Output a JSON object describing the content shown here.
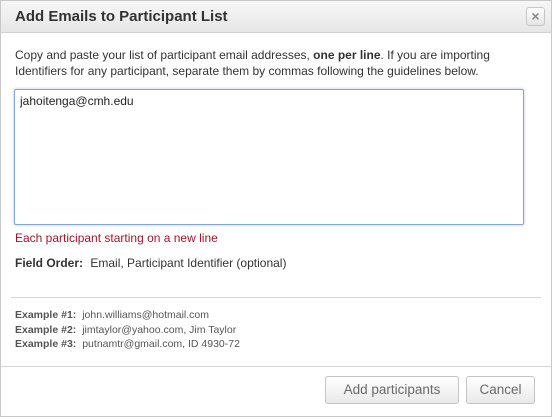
{
  "dialog": {
    "title": "Add Emails to Participant List",
    "close_glyph": "×"
  },
  "intro": {
    "text_before": "Copy and paste your list of participant email addresses, ",
    "text_bold": "one per line",
    "text_after": ". If you are importing Identifiers for any participant, separate them by commas following the guidelines below."
  },
  "textarea": {
    "value": "jahoitenga@cmh.edu"
  },
  "hint": "Each participant starting on a new line",
  "field_order": {
    "label": "Field Order:",
    "value": "Email, Participant Identifier (optional)"
  },
  "examples": [
    {
      "label": "Example #1:",
      "value": "john.williams@hotmail.com"
    },
    {
      "label": "Example #2:",
      "value": "jimtaylor@yahoo.com, Jim Taylor"
    },
    {
      "label": "Example #3:",
      "value": "putnamtr@gmail.com, ID 4930-72"
    }
  ],
  "buttons": {
    "add": "Add participants",
    "cancel": "Cancel"
  },
  "colors": {
    "hint_red": "#a3152b",
    "focus_border": "#7fa7d3"
  }
}
